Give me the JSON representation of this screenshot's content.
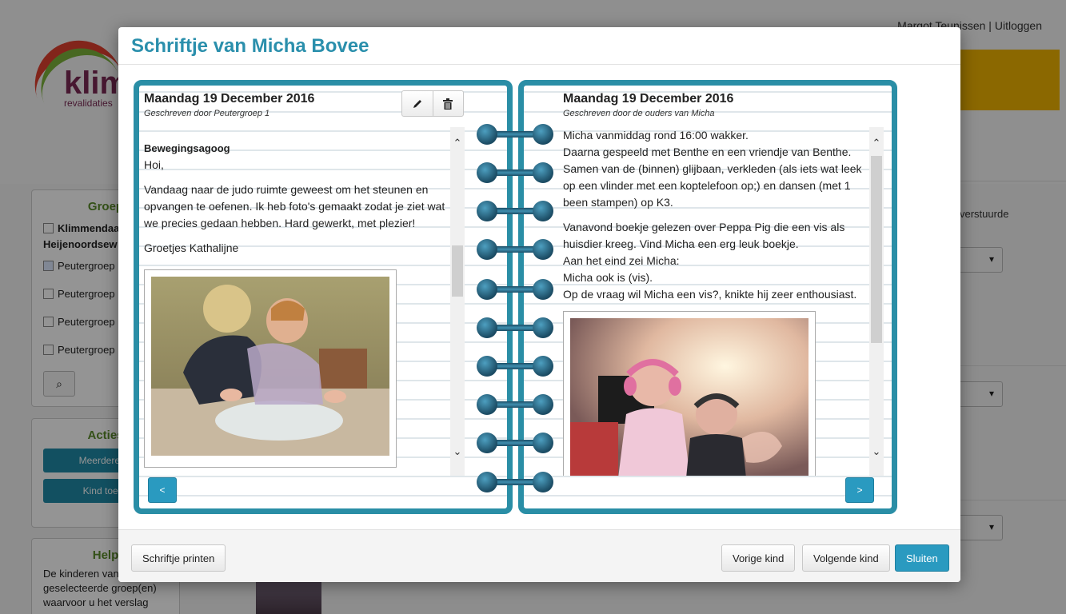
{
  "background": {
    "logo_name": "klim",
    "logo_sub": "revalidaties",
    "user_name": "Margot Teunissen",
    "logout_label": "Uitloggen",
    "groups_panel": {
      "title": "Groep",
      "items": [
        {
          "label": "Klimmendaa",
          "checked": false
        },
        {
          "label": "Heijenoordsew",
          "checked": false
        },
        {
          "label": "Peutergroep",
          "checked": true
        },
        {
          "label": "Peutergroep",
          "checked": false
        },
        {
          "label": "Peutergroep",
          "checked": false
        },
        {
          "label": "Peutergroep",
          "checked": false
        }
      ]
    },
    "actions_panel": {
      "title": "Acties",
      "btn1": "Meerdere sc",
      "btn2": "Kind toevo"
    },
    "help_panel": {
      "title": "Help",
      "text": "De kinderen van geselecteerde groep(en) waarvoor u het verslag"
    },
    "right_text": "verstuurde"
  },
  "modal": {
    "title": "Schriftje van Micha Bovee",
    "left_page": {
      "date": "Maandag 19 December 2016",
      "author": "Geschreven door Peutergroep 1",
      "heading": "Bewegingsagoog",
      "paragraphs": [
        "Hoi,",
        "Vandaag naar de judo ruimte geweest om het steunen en opvangen te oefenen. Ik heb foto's gemaakt zodat je ziet wat we precies gedaan hebben. Hard gewerkt, met plezier!",
        "Groetjes Kathalijne"
      ],
      "prev_label": "<"
    },
    "right_page": {
      "date": "Maandag 19 December 2016",
      "author": "Geschreven door de ouders van Micha",
      "para1": "Micha vanmiddag rond 16:00 wakker.\nDaarna gespeeld met Benthe en een vriendje van Benthe. Samen van de (binnen) glijbaan, verkleden (als iets wat leek op een vlinder met een koptelefoon op;) en dansen (met 1 been stampen) op K3.",
      "para2": "Vanavond boekje gelezen over Peppa Pig die een vis als huisdier kreeg. Vind Micha een erg leuk boekje.\nAan het eind zei Micha:\nMicha ook is (vis).\nOp de vraag wil Micha een vis?, knikte hij zeer enthousiast.",
      "next_label": ">"
    },
    "footer": {
      "print": "Schriftje printen",
      "prev_child": "Vorige kind",
      "next_child": "Volgende kind",
      "close": "Sluiten"
    }
  },
  "colors": {
    "accent": "#2a8fac",
    "notebook_border": "#2a8ea6",
    "primary_button": "#2a9ac0",
    "group_title": "#5a8c2a",
    "yellow_banner": "#f0b400"
  },
  "icons": {
    "edit": "pencil-icon",
    "delete": "trash-icon",
    "scroll_up": "chevron-up-icon",
    "scroll_down": "chevron-down-icon",
    "search": "search-icon"
  }
}
